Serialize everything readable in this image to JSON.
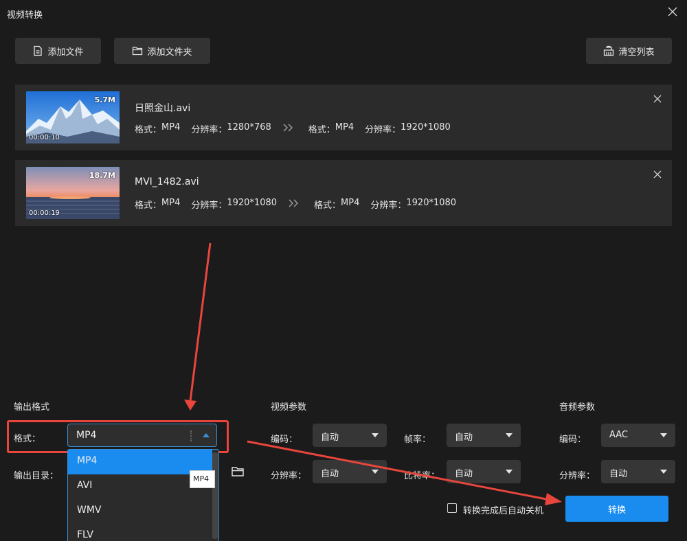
{
  "window": {
    "title": "视频转换"
  },
  "toolbar": {
    "add_file": "添加文件",
    "add_folder": "添加文件夹",
    "clear_list": "清空列表"
  },
  "files": [
    {
      "name": "日照金山.avi",
      "size": "5.7M",
      "duration": "00:00:10",
      "src_format_label": "格式：",
      "src_format": "MP4",
      "src_res_label": "分辨率：",
      "src_res": "1280*768",
      "dst_format_label": "格式：",
      "dst_format": "MP4",
      "dst_res_label": "分辨率：",
      "dst_res": "1920*1080"
    },
    {
      "name": "MVI_1482.avi",
      "size": "18.7M",
      "duration": "00:00:19",
      "src_format_label": "格式：",
      "src_format": "MP4",
      "src_res_label": "分辨率：",
      "src_res": "1920*1080",
      "dst_format_label": "格式：",
      "dst_format": "MP4",
      "dst_res_label": "分辨率：",
      "dst_res": "1920*1080"
    }
  ],
  "output": {
    "section_title": "输出格式",
    "format_label": "格式：",
    "format_value": "MP4",
    "dir_label": "输出目录："
  },
  "format_options": [
    "MP4",
    "AVI",
    "WMV",
    "FLV"
  ],
  "tooltip": "MP4",
  "video": {
    "section_title": "视频参数",
    "codec_label": "编码：",
    "codec_value": "自动",
    "framerate_label": "帧率：",
    "framerate_value": "自动",
    "res_label": "分辨率：",
    "res_value": "自动",
    "bitrate_label": "比特率：",
    "bitrate_value": "自动"
  },
  "audio": {
    "section_title": "音频参数",
    "codec_label": "编码：",
    "codec_value": "AAC",
    "res_label": "分辨率：",
    "res_value": "自动"
  },
  "shutdown_label": "转换完成后自动关机",
  "convert_label": "转换",
  "colors": {
    "background": "#1b1b1b",
    "panel": "#2b2b2b",
    "accent": "#1a8cf0",
    "annotation": "#e8463c"
  }
}
